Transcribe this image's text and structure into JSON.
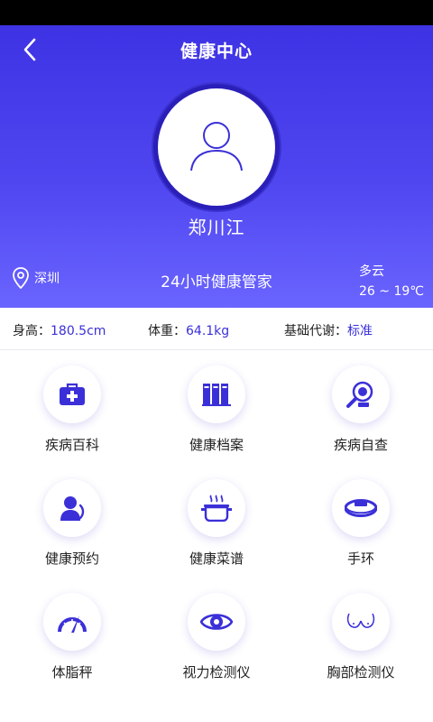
{
  "header": {
    "title": "健康中心",
    "back": "back-arrow-icon"
  },
  "profile": {
    "name": "郑川江",
    "avatar_icon": "user-icon"
  },
  "info": {
    "city": "深圳",
    "slogan": "24小时健康管家",
    "weather": "多云",
    "temperature": "26 ~ 19℃"
  },
  "metrics": [
    {
      "label": "身高：",
      "value": "180.5cm"
    },
    {
      "label": "体重：",
      "value": "64.1kg"
    },
    {
      "label": "基础代谢：",
      "value": "标准"
    }
  ],
  "menu": [
    {
      "label": "疾病百科",
      "icon": "medical-kit-icon"
    },
    {
      "label": "健康档案",
      "icon": "binders-icon"
    },
    {
      "label": "疾病自查",
      "icon": "magnifier-icon"
    },
    {
      "label": "健康预约",
      "icon": "doctor-phone-icon"
    },
    {
      "label": "健康菜谱",
      "icon": "steaming-pot-icon"
    },
    {
      "label": "手环",
      "icon": "wristband-icon"
    },
    {
      "label": "体脂秤",
      "icon": "gauge-icon"
    },
    {
      "label": "视力检测仪",
      "icon": "eye-icon"
    },
    {
      "label": "胸部检测仪",
      "icon": "chest-icon"
    }
  ],
  "colors": {
    "accent": "#3b30d8",
    "hero_top": "#3e33e4",
    "hero_bottom": "#6a64ff"
  }
}
